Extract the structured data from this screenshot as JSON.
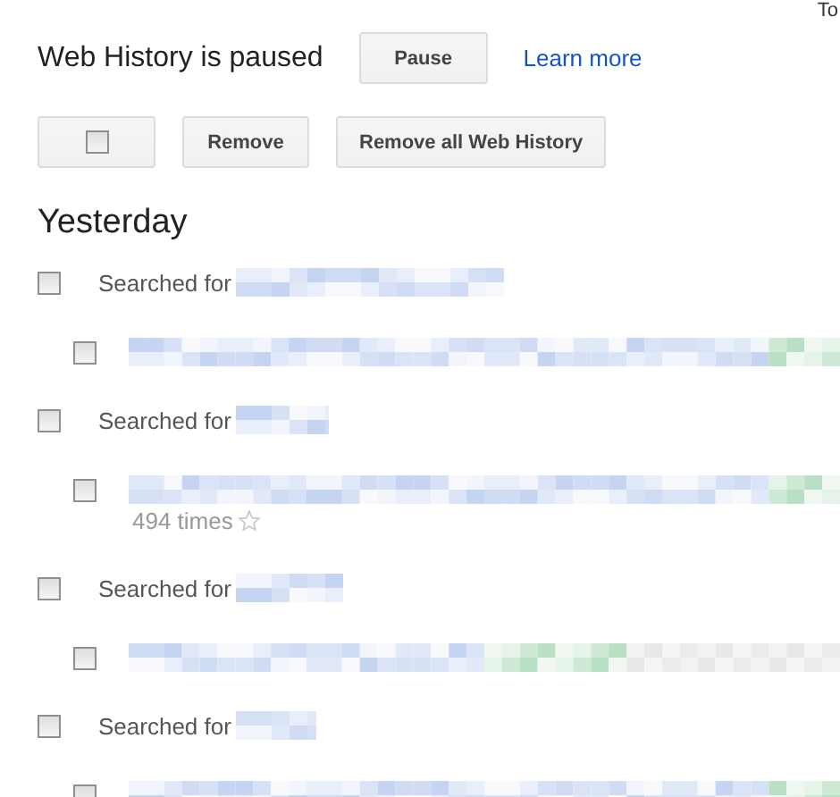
{
  "corner_text": "To",
  "status": {
    "text": "Web History is paused",
    "button": "Pause",
    "link": "Learn more"
  },
  "toolbar": {
    "select_all_checked": false,
    "buttons": [
      "Remove",
      "Remove all Web History"
    ]
  },
  "day_heading": "Yesterday",
  "entries": [
    {
      "label": "Searched for",
      "checked": false,
      "results": [
        {
          "checked": false
        }
      ]
    },
    {
      "label": "Searched for",
      "checked": false,
      "results": [
        {
          "checked": false,
          "visits": "494 times",
          "starred": false
        }
      ]
    },
    {
      "label": "Searched for",
      "checked": false,
      "results": [
        {
          "checked": false
        }
      ]
    },
    {
      "label": "Searched for",
      "checked": false,
      "results": [
        {
          "checked": false
        }
      ]
    }
  ]
}
